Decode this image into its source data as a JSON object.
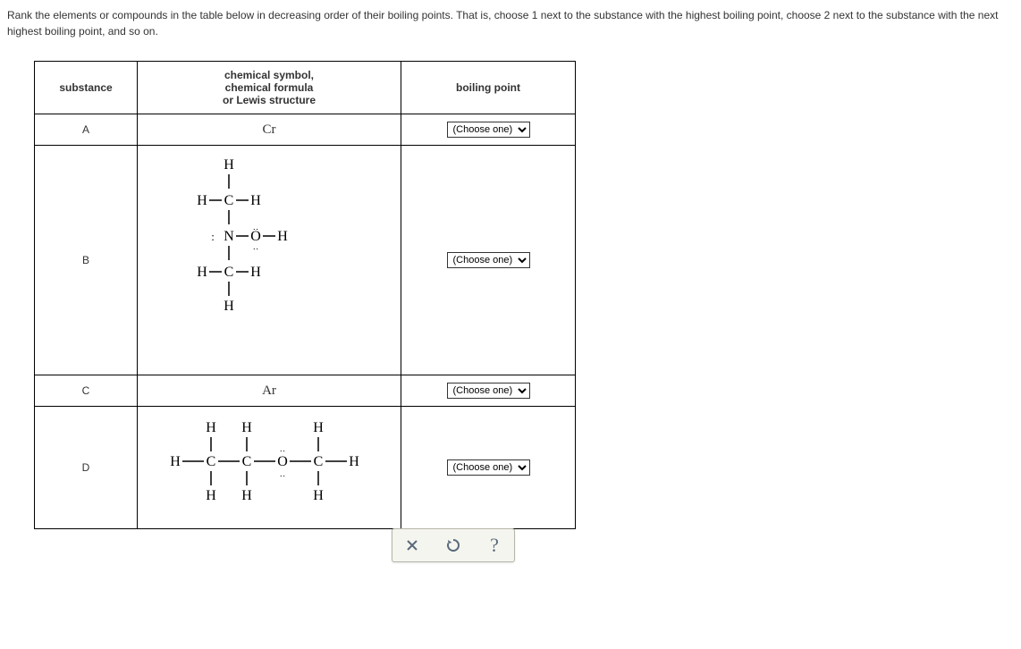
{
  "question": "Rank the elements or compounds in the table below in decreasing order of their boiling points. That is, choose 1 next to the substance with the highest boiling point, choose 2 next to the substance with the next highest boiling point, and so on.",
  "headers": {
    "substance": "substance",
    "structure": "chemical symbol,\nchemical formula\nor Lewis structure",
    "boiling": "boiling point"
  },
  "rows": {
    "A": {
      "label": "A",
      "structure_text": "Cr"
    },
    "B": {
      "label": "B",
      "structure_desc": "Lewis structure of N,N-dimethylhydroxylamine (CH3)2N-O-H"
    },
    "C": {
      "label": "C",
      "structure_text": "Ar"
    },
    "D": {
      "label": "D",
      "structure_desc": "Lewis structure of methyl ethyl ether CH3-CH2-O-CH3"
    }
  },
  "select_placeholder": "(Choose one)",
  "controls": {
    "close": "close",
    "reset": "reset",
    "help": "?"
  }
}
